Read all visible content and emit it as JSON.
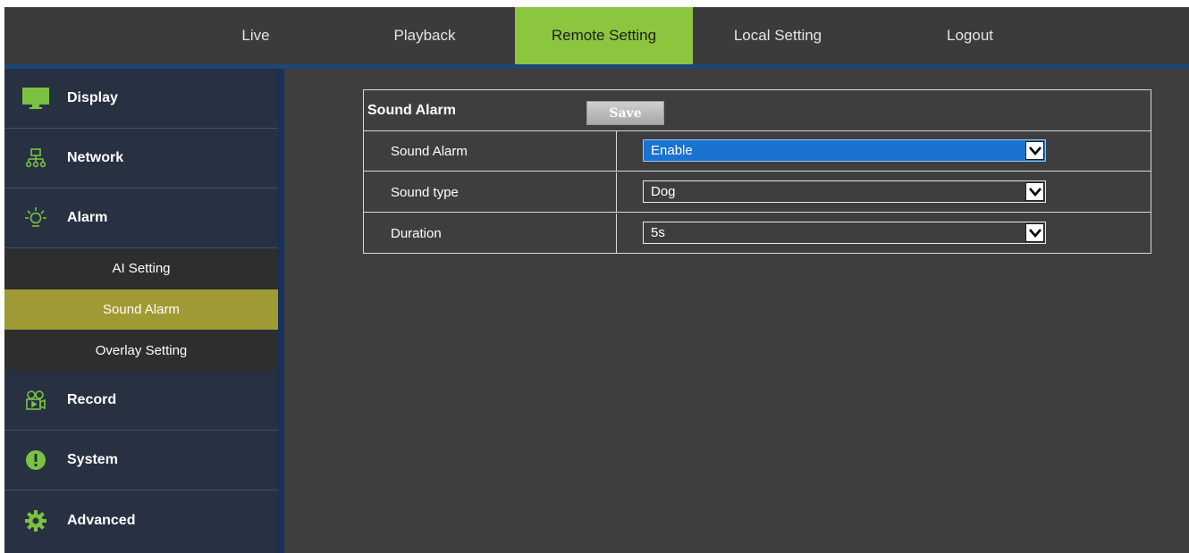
{
  "topnav": {
    "tabs": [
      {
        "label": "Live",
        "active": false
      },
      {
        "label": "Playback",
        "active": false
      },
      {
        "label": "Remote Setting",
        "active": true
      },
      {
        "label": "Local Setting",
        "active": false
      },
      {
        "label": "Logout",
        "active": false
      }
    ]
  },
  "sidebar": {
    "items": [
      {
        "label": "Display",
        "icon": "monitor-icon"
      },
      {
        "label": "Network",
        "icon": "network-icon"
      },
      {
        "label": "Alarm",
        "icon": "alarm-light-icon"
      },
      {
        "label": "Record",
        "icon": "camera-record-icon"
      },
      {
        "label": "System",
        "icon": "exclamation-icon"
      },
      {
        "label": "Advanced",
        "icon": "gear-icon"
      }
    ],
    "alarm_subitems": [
      {
        "label": "AI Setting",
        "active": false
      },
      {
        "label": "Sound Alarm",
        "active": true
      },
      {
        "label": "Overlay Setting",
        "active": false
      }
    ]
  },
  "panel": {
    "title": "Sound Alarm",
    "save_label": "Save",
    "rows": [
      {
        "label": "Sound Alarm",
        "value": "Enable",
        "focused": true
      },
      {
        "label": "Sound type",
        "value": "Dog",
        "focused": false
      },
      {
        "label": "Duration",
        "value": "5s",
        "focused": false
      }
    ]
  },
  "colors": {
    "active_tab": "#8cc63f",
    "active_subitem": "#a09a34",
    "sidebar_bg": "#273142",
    "content_bg": "#3e3e3e",
    "nav_divider": "#1c4676",
    "focused_select": "#1a73d0"
  }
}
